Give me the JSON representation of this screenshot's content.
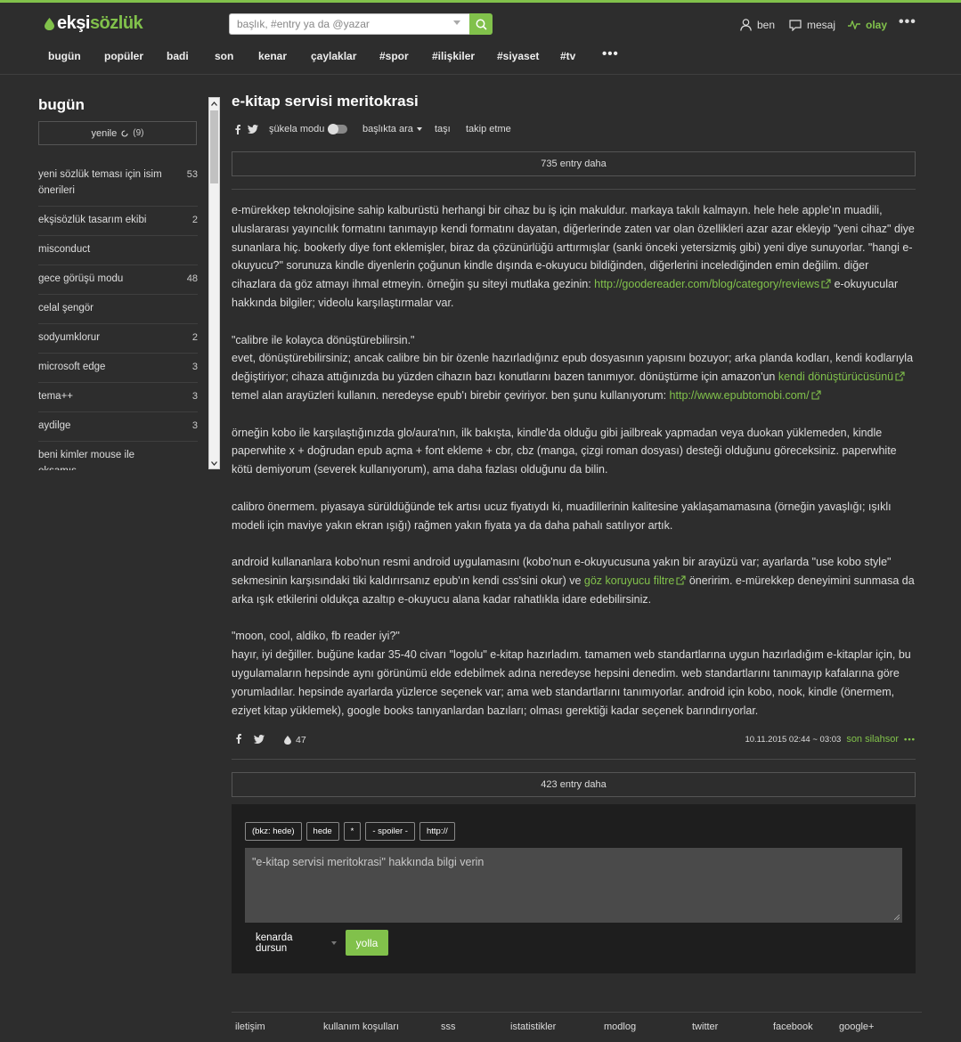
{
  "header": {
    "logo_main": "ekşi",
    "logo_accent": "sözlük",
    "search_placeholder": "başlık, #entry ya da @yazar",
    "user_nav": {
      "ben": "ben",
      "mesaj": "mesaj",
      "olay": "olay",
      "more": "•••"
    },
    "topics": [
      "bugün",
      "popüler",
      "badi",
      "son",
      "kenar",
      "çaylaklar",
      "#spor",
      "#ilişkiler",
      "#siyaset",
      "#tv"
    ],
    "topics_more": "•••"
  },
  "sidebar": {
    "title": "bugün",
    "refresh_label": "yenile",
    "refresh_count": "(9)",
    "items": [
      {
        "title": "yeni sözlük teması için isim önerileri",
        "count": "53"
      },
      {
        "title": "ekşisözlük tasarım ekibi",
        "count": "2"
      },
      {
        "title": "misconduct",
        "count": ""
      },
      {
        "title": "gece görüşü modu",
        "count": "48"
      },
      {
        "title": "celal şengör",
        "count": ""
      },
      {
        "title": "sodyumklorur",
        "count": "2"
      },
      {
        "title": "microsoft edge",
        "count": "3"
      },
      {
        "title": "tema++",
        "count": "3"
      },
      {
        "title": "aydilge",
        "count": "3"
      },
      {
        "title": "beni kimler mouse ile okşamış",
        "count": ""
      }
    ]
  },
  "main": {
    "title": "e-kitap servisi meritokrasi",
    "subnav": {
      "sukela": "şükela modu",
      "search_in": "başlıkta ara",
      "move": "taşı",
      "follow": "takip etme"
    },
    "more_before": "735 entry daha",
    "more_after": "423 entry daha",
    "entry": {
      "p1a": "e-mürekkep teknolojisine sahip kalburüstü herhangi bir cihaz bu iş için makuldur. markaya takılı kalmayın. hele hele apple'ın muadili, uluslararası yayıncılık formatını tanımayıp kendi formatını dayatan, diğerlerinde zaten var olan özellikleri azar azar ekleyip \"yeni cihaz\" diye sunanlara hiç. bookerly diye font eklemişler, biraz da çözünürlüğü arttırmışlar (sanki önceki yetersizmiş gibi) yeni diye sunuyorlar. \"hangi e-okuyucu?\" sorunuza kindle diyenlerin çoğunun kindle dışında e-okuyucu bildiğinden, diğerlerini incelediğinden emin değilim. diğer cihazlara da göz atmayı ihmal etmeyin. örneğin şu siteyi mutlaka gezinin: ",
      "p1_link": "http://goodereader.com/blog/category/reviews",
      "p1b": " e-okuyucular hakkında bilgiler; videolu karşılaştırmalar var.",
      "p2_quote": "\"calibre ile kolayca dönüştürebilirsin.\"",
      "p2a": "evet, dönüştürebilirsiniz; ancak calibre bin bir özenle hazırladığınız epub dosyasının yapısını bozuyor; arka planda kodları, kendi kodlarıyla değiştiriyor; cihaza attığınızda bu yüzden cihazın bazı konutlarını bazen tanımıyor. dönüştürme için amazon'un ",
      "p2_link1": "kendi dönüştürücüsünü",
      "p2b": " temel alan arayüzleri kullanın. neredeyse epub'ı birebir çeviriyor. ben şunu kullanıyorum: ",
      "p2_link2": "http://www.epubtomobi.com/",
      "p3": "örneğin kobo ile karşılaştığınızda glo/aura'nın, ilk bakışta, kindle'da olduğu gibi jailbreak yapmadan veya duokan yüklemeden, kindle paperwhite x + doğrudan epub açma + font ekleme + cbr, cbz (manga, çizgi roman dosyası) desteği olduğunu göreceksiniz. paperwhite kötü demiyorum (severek kullanıyorum), ama daha fazlası olduğunu da bilin.",
      "p4": "calibro önermem. piyasaya sürüldüğünde tek artısı ucuz fiyatıydı ki, muadillerinin kalitesine yaklaşamamasına (örneğin yavaşlığı; ışıklı modeli için maviye yakın ekran ışığı) rağmen yakın fiyata ya da daha pahalı satılıyor artık.",
      "p5a": "android kullananlara kobo'nun resmi android uygulamasını (kobo'nun e-okuyucusuna yakın bir arayüzü var; ayarlarda \"use kobo style\" sekmesinin karşısındaki tiki kaldırırsanız epub'ın kendi css'sini okur) ve ",
      "p5_link": "göz koruyucu filtre",
      "p5b": " öneririm. e-mürekkep deneyimini sunmasa da arka ışık etkilerini oldukça azaltıp e-okuyucu alana kadar rahatlıkla idare edebilirsiniz.",
      "p6_quote": "\"moon, cool, aldiko, fb reader iyi?\"",
      "p6": "hayır, iyi değiller. buğüne kadar 35-40 civarı \"logolu\" e-kitap hazırladım. tamamen web standartlarına uygun hazırladığım e-kitaplar için, bu uygulamaların hepsinde aynı görünümü elde edebilmek adına neredeyse hepsini denedim. web standartlarını tanımayıp kafalarına göre yorumladılar. hepsinde ayarlarda yüzlerce seçenek var; ama web standartlarını tanımıyorlar. android için kobo, nook, kindle (önermem, eziyet kitap yüklemek), google books tanıyanlardan bazıları; olması gerektiği kadar seçenek barındırıyorlar.",
      "fav_count": "47",
      "date": "10.11.2015 02:44 ~ 03:03",
      "author": "son silahsor",
      "more": "•••"
    }
  },
  "editor": {
    "tools": [
      "(bkz: hede)",
      "hede",
      "*",
      "- spoiler -",
      "http://"
    ],
    "placeholder": "\"e-kitap servisi meritokrasi\" hakkında bilgi verin",
    "mode": "kenarda dursun",
    "send": "yolla"
  },
  "footer": [
    "iletişim",
    "kullanım koşulları",
    "sss",
    "istatistikler",
    "modlog",
    "twitter",
    "facebook",
    "google+"
  ],
  "colors": {
    "accent": "#81c14b",
    "background": "#2d2d2d"
  }
}
